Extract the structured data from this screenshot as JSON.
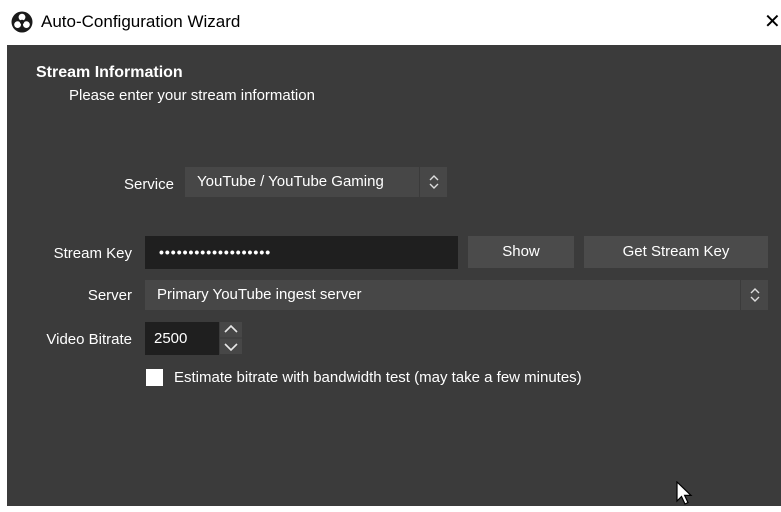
{
  "window": {
    "title": "Auto-Configuration Wizard",
    "app_icon": "obs-logo-icon",
    "close_icon": "close-icon",
    "close_glyph": "✕"
  },
  "section": {
    "title": "Stream Information",
    "subtitle": "Please enter your stream information"
  },
  "service": {
    "label": "Service",
    "value": "YouTube / YouTube Gaming"
  },
  "stream_key": {
    "label": "Stream Key",
    "value": "•••••••••••••••••••",
    "show_label": "Show",
    "get_key_label": "Get Stream Key"
  },
  "server": {
    "label": "Server",
    "value": "Primary YouTube ingest server"
  },
  "bitrate": {
    "label": "Video Bitrate",
    "value": "2500"
  },
  "estimate": {
    "label": "Estimate bitrate with bandwidth test (may take a few minutes)",
    "checked": false
  },
  "colors": {
    "window_bg": "#3b3b3b",
    "field_bg": "#474747",
    "input_bg": "#1f1f1f",
    "button_bg": "#4b4b4b"
  }
}
